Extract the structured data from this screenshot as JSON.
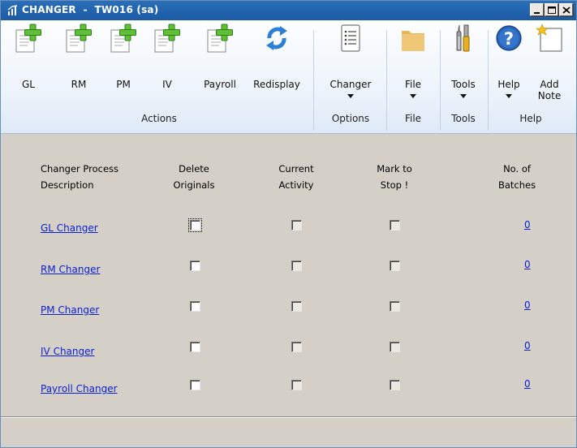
{
  "window": {
    "title": "CHANGER  -  TW016 (sa)",
    "buttons": [
      "minimize",
      "maximize",
      "close"
    ]
  },
  "ribbon": {
    "actions": [
      {
        "label": "GL",
        "icon": "add-document-icon"
      },
      {
        "label": "RM",
        "icon": "add-document-icon"
      },
      {
        "label": "PM",
        "icon": "add-document-icon"
      },
      {
        "label": "IV",
        "icon": "add-document-icon"
      },
      {
        "label": "Payroll",
        "icon": "add-document-icon"
      },
      {
        "label": "Redisplay",
        "icon": "refresh-icon"
      }
    ],
    "actions_group_label": "Actions",
    "changer": {
      "label": "Changer",
      "icon": "list-document-icon"
    },
    "options_group_label": "Options",
    "file": {
      "label": "File",
      "icon": "folder-icon"
    },
    "file_group_label": "File",
    "tools": {
      "label": "Tools",
      "icon": "tools-icon"
    },
    "tools_group_label": "Tools",
    "help": {
      "label": "Help",
      "icon": "help-icon"
    },
    "add_note": {
      "label": "Add\nNote",
      "icon": "note-icon"
    },
    "help_group_label": "Help"
  },
  "table": {
    "headers": {
      "description": "Changer Process\nDescription",
      "delete_originals": "Delete\nOriginals",
      "current_activity": "Current\nActivity",
      "mark_to_stop": "Mark to\nStop !",
      "no_of_batches": "No. of\nBatches"
    },
    "rows": [
      {
        "name": "GL Changer",
        "delete_originals": false,
        "current_activity": false,
        "mark_to_stop": false,
        "batches": "0"
      },
      {
        "name": "RM Changer",
        "delete_originals": false,
        "current_activity": false,
        "mark_to_stop": false,
        "batches": "0"
      },
      {
        "name": "PM Changer",
        "delete_originals": false,
        "current_activity": false,
        "mark_to_stop": false,
        "batches": "0"
      },
      {
        "name": "IV  Changer",
        "delete_originals": false,
        "current_activity": false,
        "mark_to_stop": false,
        "batches": "0"
      },
      {
        "name": "Payroll Changer",
        "delete_originals": false,
        "current_activity": false,
        "mark_to_stop": false,
        "batches": "0"
      }
    ]
  }
}
